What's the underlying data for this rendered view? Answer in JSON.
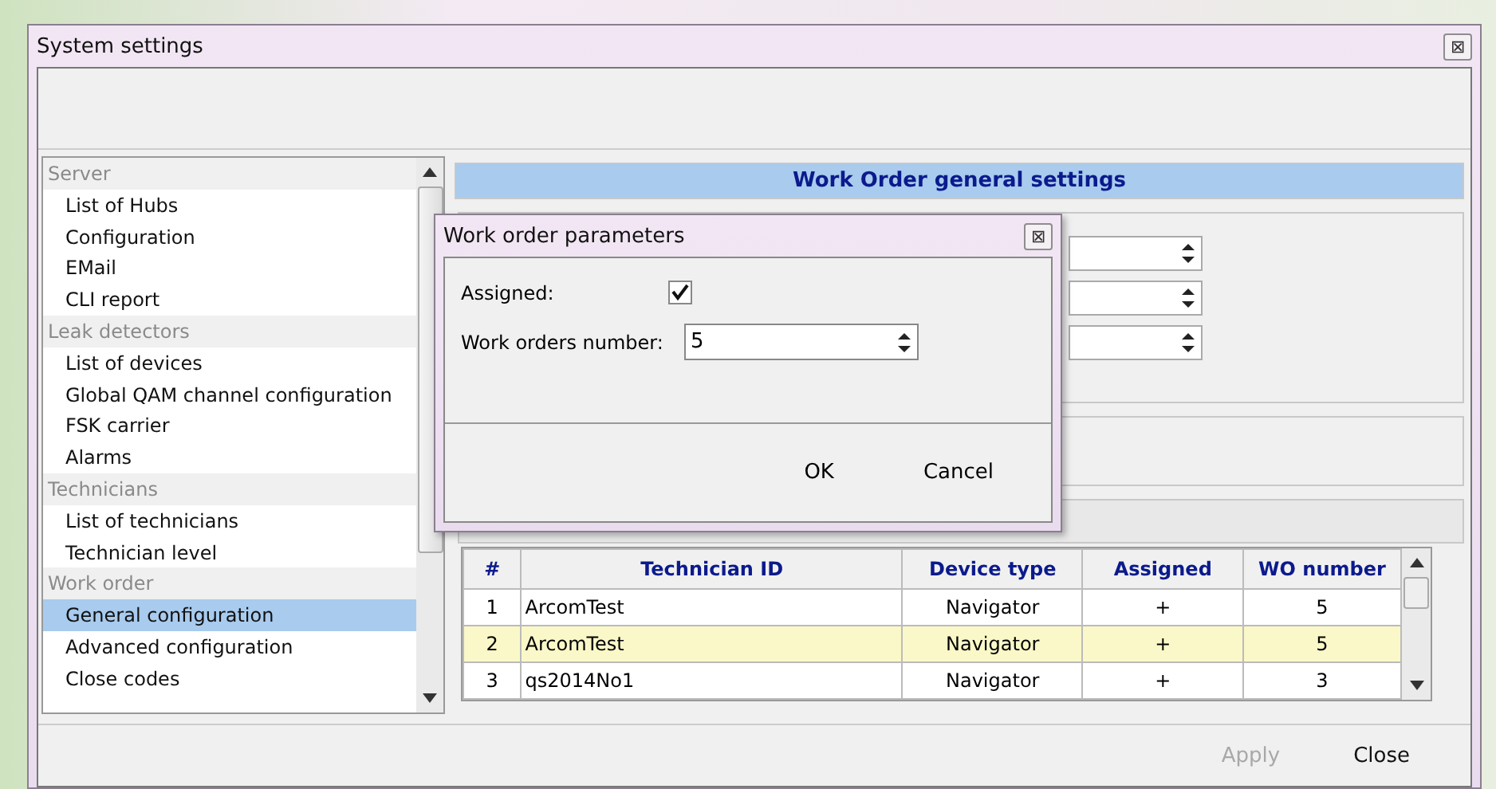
{
  "window": {
    "title": "System settings",
    "close": "⊠"
  },
  "sidebar": {
    "items": [
      {
        "kind": "group",
        "label": "Server",
        "selected": false
      },
      {
        "kind": "item",
        "label": "List of Hubs",
        "selected": false
      },
      {
        "kind": "item",
        "label": "Configuration",
        "selected": false
      },
      {
        "kind": "item",
        "label": "EMail",
        "selected": false
      },
      {
        "kind": "item",
        "label": "CLI report",
        "selected": false
      },
      {
        "kind": "group",
        "label": "Leak detectors",
        "selected": false
      },
      {
        "kind": "item",
        "label": "List of devices",
        "selected": false
      },
      {
        "kind": "item",
        "label": "Global QAM channel configuration",
        "selected": false
      },
      {
        "kind": "item",
        "label": "FSK carrier",
        "selected": false
      },
      {
        "kind": "item",
        "label": "Alarms",
        "selected": false
      },
      {
        "kind": "group",
        "label": "Technicians",
        "selected": false
      },
      {
        "kind": "item",
        "label": "List of technicians",
        "selected": false
      },
      {
        "kind": "item",
        "label": "Technician level",
        "selected": false
      },
      {
        "kind": "group",
        "label": "Work order",
        "selected": false
      },
      {
        "kind": "item",
        "label": "General configuration",
        "selected": true
      },
      {
        "kind": "item",
        "label": "Advanced configuration",
        "selected": false
      },
      {
        "kind": "item",
        "label": "Close codes",
        "selected": false
      }
    ]
  },
  "panel": {
    "title": "Work Order general settings"
  },
  "table": {
    "columns": [
      "#",
      "Technician ID",
      "Device type",
      "Assigned",
      "WO number"
    ],
    "rows": [
      {
        "cells": [
          "1",
          "ArcomTest",
          "Navigator",
          "+",
          "5"
        ],
        "selected": false
      },
      {
        "cells": [
          "2",
          "ArcomTest",
          "Navigator",
          "+",
          "5"
        ],
        "selected": true
      },
      {
        "cells": [
          "3",
          "qs2014No1",
          "Navigator",
          "+",
          "3"
        ],
        "selected": false
      }
    ]
  },
  "footer": {
    "buttons": [
      {
        "label": "Apply",
        "disabled": true
      },
      {
        "label": "Close",
        "disabled": false
      }
    ]
  },
  "dialog": {
    "title": "Work order parameters",
    "close": "⊠",
    "assigned_label": "Assigned:",
    "assigned_checked": true,
    "number_label": "Work orders number:",
    "number_value": "5",
    "buttons": [
      "OK",
      "Cancel"
    ]
  }
}
